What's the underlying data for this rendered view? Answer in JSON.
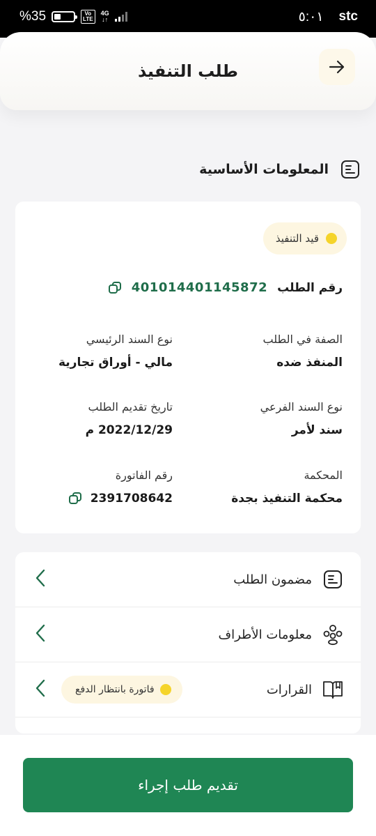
{
  "status_bar": {
    "battery": "35",
    "percent_sign": "%",
    "volte": "Vo\nLTE",
    "network": "4G",
    "time": "٥:٠١",
    "carrier": "stc"
  },
  "header": {
    "title": "طلب التنفيذ"
  },
  "section": {
    "title": "المعلومات الأساسية"
  },
  "info": {
    "status_badge": "قيد التنفيذ",
    "request_number_label": "رقم الطلب",
    "request_number": "401014401145872",
    "fields": [
      {
        "label": "الصفة في الطلب",
        "value": "المنفذ ضده"
      },
      {
        "label": "نوع السند الرئيسي",
        "value": "مالي - أوراق تجارية"
      },
      {
        "label": "نوع السند الفرعي",
        "value": "سند لأمر"
      },
      {
        "label": "تاريخ تقديم الطلب",
        "value": "2022/12/29 م"
      },
      {
        "label": "المحكمة",
        "value": "محكمة التنفيذ بجدة"
      },
      {
        "label": "رقم الفاتورة",
        "value": "2391708642"
      }
    ]
  },
  "list": [
    {
      "label": "مضمون الطلب",
      "icon": "document-icon"
    },
    {
      "label": "معلومات الأطراف",
      "icon": "people-icon"
    },
    {
      "label": "القرارات",
      "icon": "book-icon",
      "badge": "فاتورة بانتظار الدفع"
    }
  ],
  "cta": {
    "label": "تقديم طلب إجراء"
  },
  "colors": {
    "primary": "#1f8654",
    "accent_green": "#1f6d4a",
    "badge_bg": "#fdf6e1",
    "badge_dot": "#f5d42a"
  }
}
